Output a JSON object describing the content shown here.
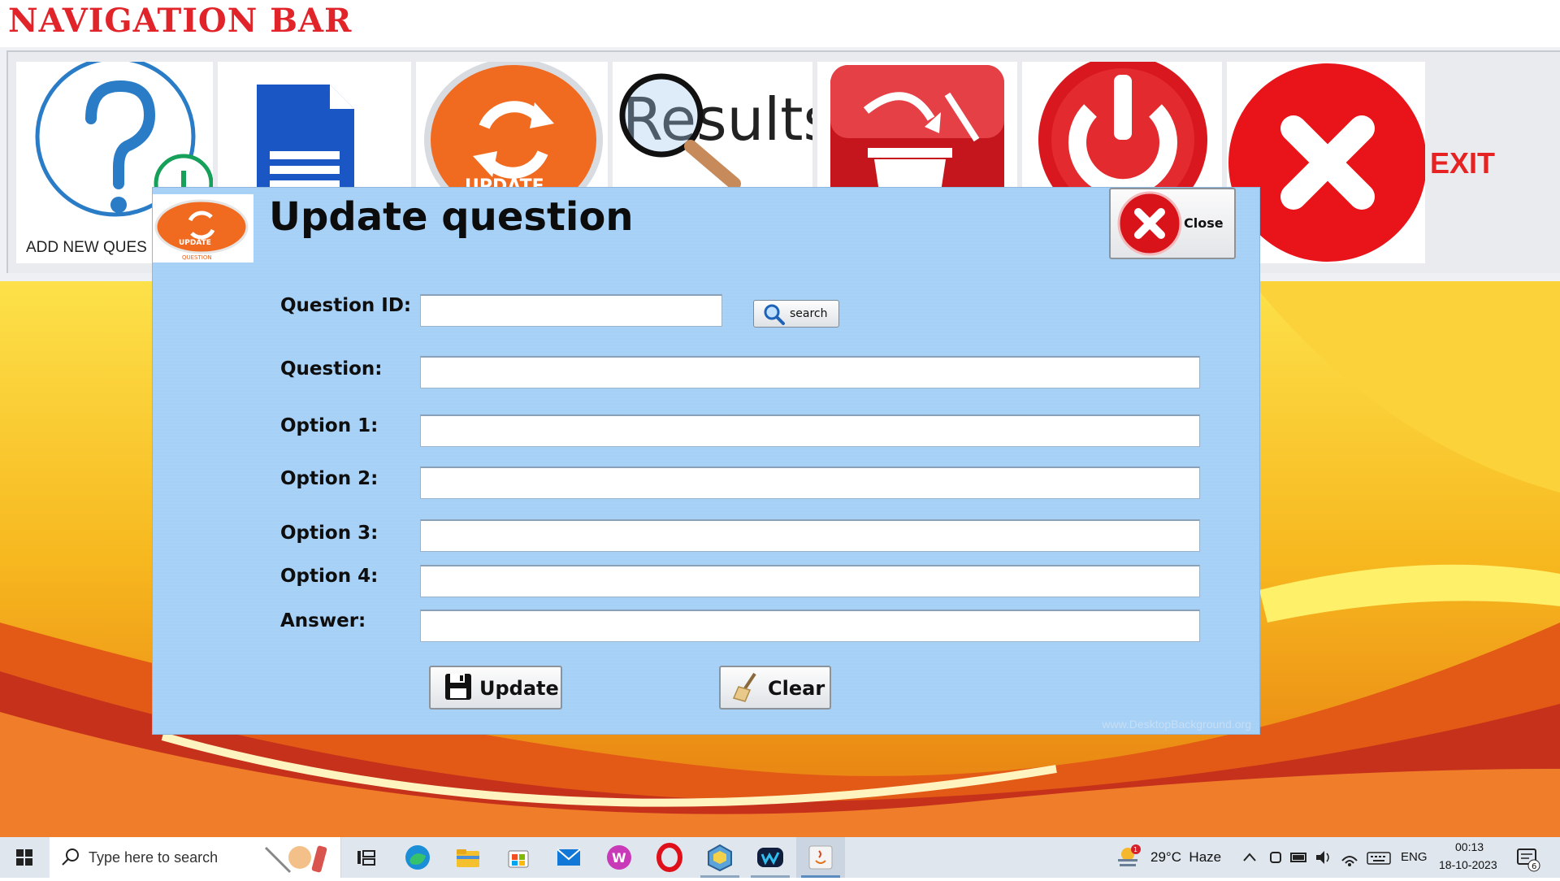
{
  "nav": {
    "title": "NAVIGATION BAR",
    "add_label": "ADD NEW QUES",
    "exit_label": "EXIT",
    "tiles": [
      {
        "icon": "add-question-icon"
      },
      {
        "icon": "document-icon"
      },
      {
        "icon": "update-icon"
      },
      {
        "icon": "results-icon",
        "text": "Results"
      },
      {
        "icon": "delete-icon"
      },
      {
        "icon": "power-icon"
      },
      {
        "icon": "exit-x-icon"
      }
    ],
    "update_tile_text": "UPDATE"
  },
  "dialog": {
    "title": "Update question",
    "logo_text": "UPDATE",
    "logo_subtext": "QUESTION",
    "close_label": "Close",
    "search_label": "search",
    "fields": {
      "question_id": {
        "label": "Question ID:",
        "value": ""
      },
      "question": {
        "label": "Question:",
        "value": ""
      },
      "option1": {
        "label": "Option 1:",
        "value": ""
      },
      "option2": {
        "label": "Option 2:",
        "value": ""
      },
      "option3": {
        "label": "Option 3:",
        "value": ""
      },
      "option4": {
        "label": "Option 4:",
        "value": ""
      },
      "answer": {
        "label": "Answer:",
        "value": ""
      }
    },
    "update_label": "Update",
    "clear_label": "Clear",
    "watermark": "www.DesktopBackground.org"
  },
  "taskbar": {
    "search_placeholder": "Type here to search",
    "weather": "29°C  Haze",
    "weather_badge": "1",
    "language": "ENG",
    "time": "00:13",
    "date": "18-10-2023",
    "notification_count": "6",
    "apps": [
      "task-view-icon",
      "edge-icon",
      "file-explorer-icon",
      "store-icon",
      "mail-icon",
      "wps-icon",
      "opera-icon",
      "virtualbox-icon",
      "webex-icon",
      "java-icon"
    ]
  },
  "colors": {
    "title_red": "#e0242a",
    "dialog_blue": "#a9d2f6",
    "taskbar": "#dfe6ee"
  }
}
